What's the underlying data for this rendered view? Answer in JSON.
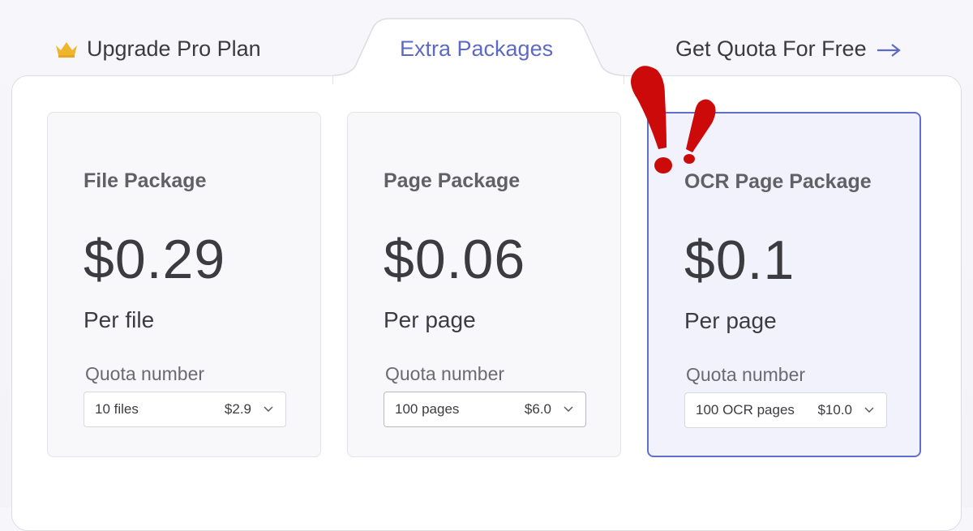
{
  "tabs": {
    "upgrade_label": "Upgrade Pro Plan",
    "extra_label": "Extra Packages",
    "free_label": "Get Quota For Free"
  },
  "accent_color": "#5d6ac4",
  "icons": {
    "crown": "crown-icon",
    "arrow": "arrow-right-icon",
    "chevron": "chevron-down-icon",
    "exclamation": "double-exclamation-icon"
  },
  "packages": [
    {
      "title": "File Package",
      "price": "$0.29",
      "unit": "Per file",
      "quota_label": "Quota number",
      "option": "10 files",
      "option_price": "$2.9",
      "selected": false
    },
    {
      "title": "Page Package",
      "price": "$0.06",
      "unit": "Per page",
      "quota_label": "Quota number",
      "option": "100 pages",
      "option_price": "$6.0",
      "selected": false
    },
    {
      "title": "OCR Page Package",
      "price": "$0.1",
      "unit": "Per page",
      "quota_label": "Quota number",
      "option": "100 OCR pages",
      "option_price": "$10.0",
      "selected": true
    }
  ]
}
